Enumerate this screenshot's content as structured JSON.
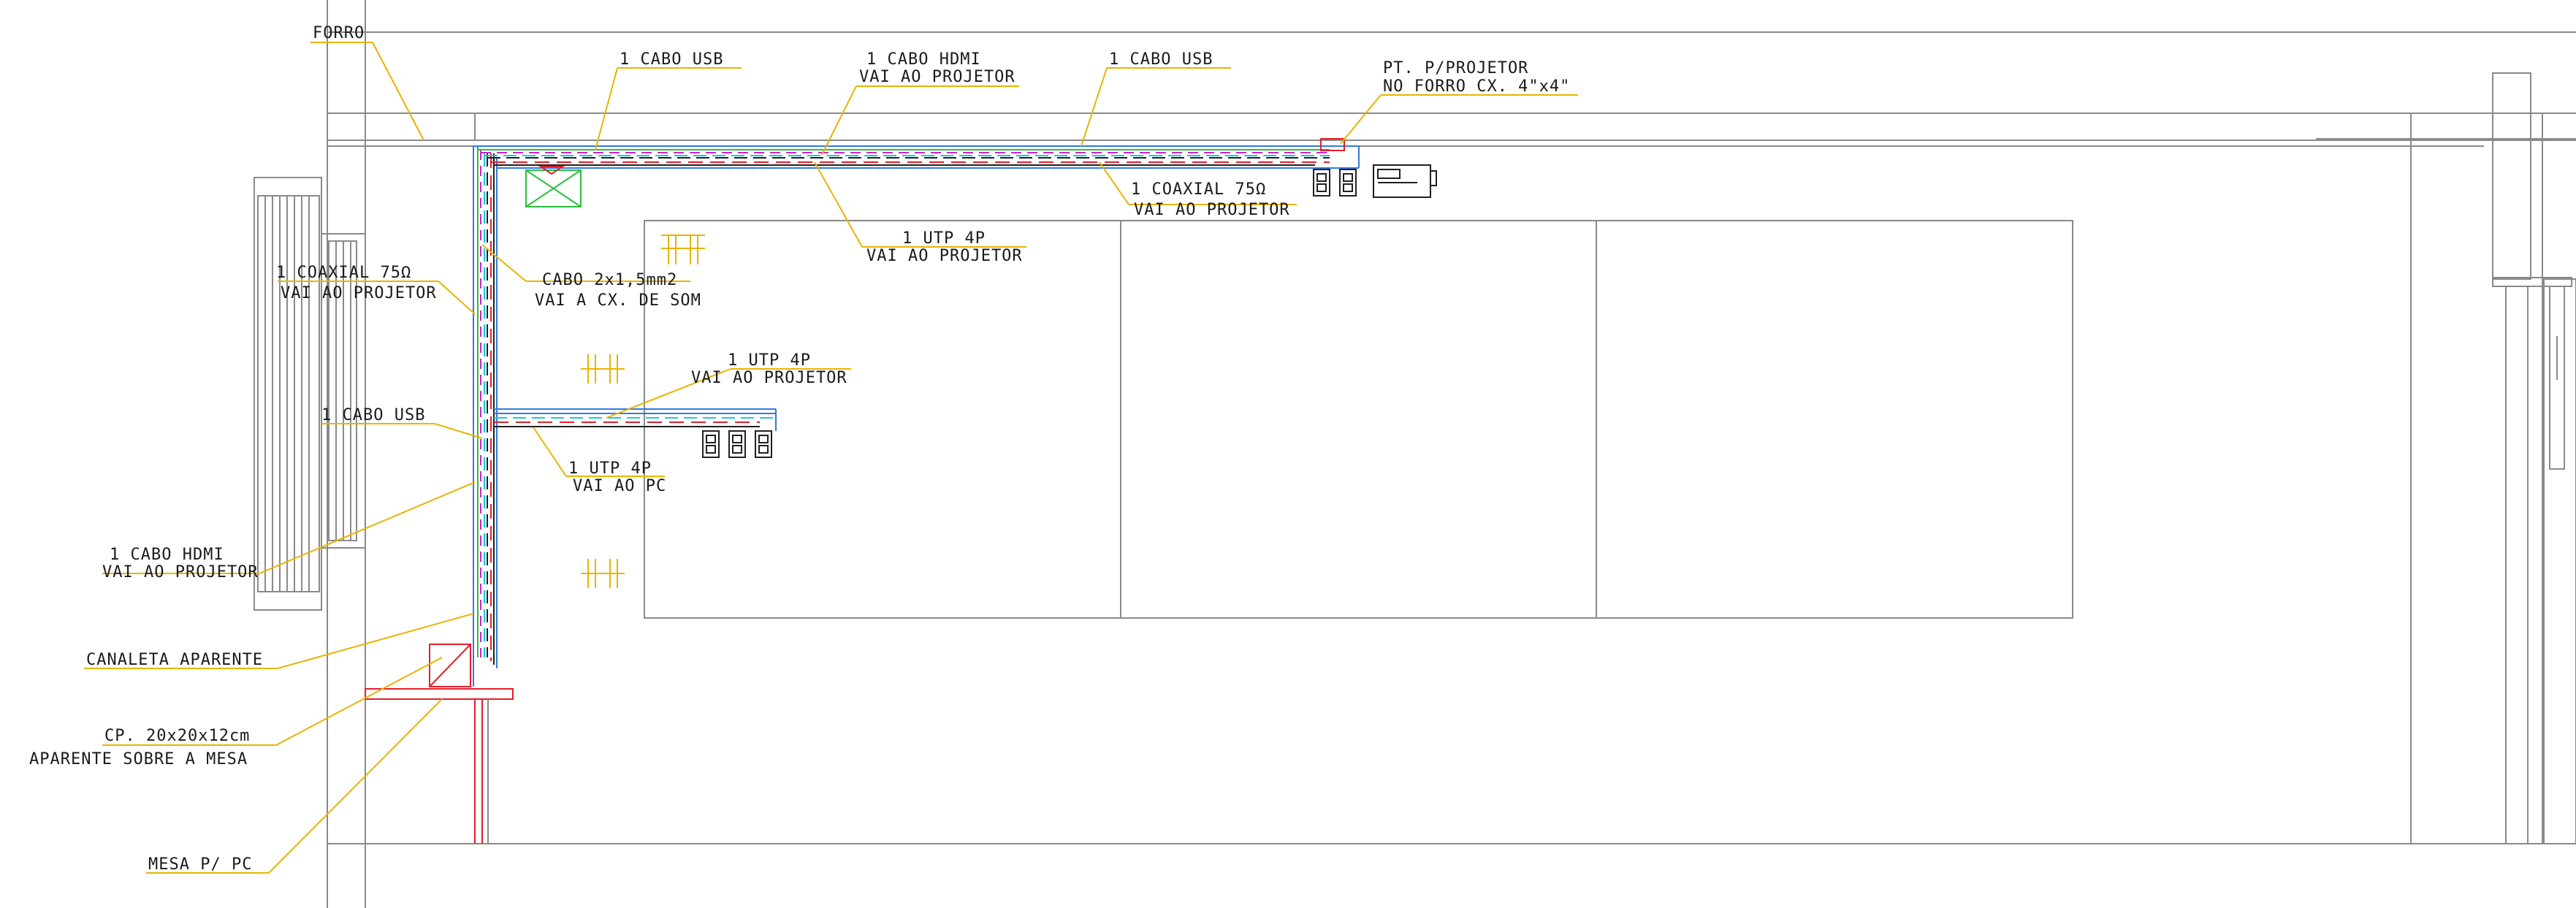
{
  "colors": {
    "background": "#ffffff",
    "structure": "#8a8a8a",
    "leader": "#e8b400",
    "underline": "#e8b400",
    "red": "#e0202a",
    "blue": "#2f7be0",
    "cyan": "#1ec8d8",
    "green": "#2bbf3a",
    "magenta": "#d020d0",
    "dark": "#202020",
    "text": "#1a1a1a"
  },
  "labels": {
    "forro": "FORRO",
    "usb_top_left": "1 CABO USB",
    "hdmi_top_1": "1 CABO HDMI",
    "hdmi_top_2": "VAI AO PROJETOR",
    "usb_top_right": "1 CABO USB",
    "pt_projetor_1": "PT. P/PROJETOR",
    "pt_projetor_2": "NO FORRO CX. 4\"x4\"",
    "coaxial_right_1": "1 COAXIAL 75Ω",
    "coaxial_right_2": "VAI AO PROJETOR",
    "utp_top_1": "1 UTP 4P",
    "utp_top_2": "VAI AO PROJETOR",
    "coaxial_left_1": "1 COAXIAL 75Ω",
    "coaxial_left_2": "VAI AO PROJETOR",
    "cabo_som_1": "CABO 2x1,5mm2",
    "cabo_som_2": "VAI A CX. DE SOM",
    "utp_mid_1": "1 UTP 4P",
    "utp_mid_2": "VAI AO PROJETOR",
    "usb_left": "1 CABO USB",
    "utp_pc_1": "1 UTP 4P",
    "utp_pc_2": "VAI AO PC",
    "hdmi_left_1": "1 CABO HDMI",
    "hdmi_left_2": "VAI AO PROJETOR",
    "canaleta": "CANALETA APARENTE",
    "cp_1": "CP. 20x20x12cm",
    "cp_2": "APARENTE SOBRE A MESA",
    "mesa": "MESA P/ PC"
  }
}
